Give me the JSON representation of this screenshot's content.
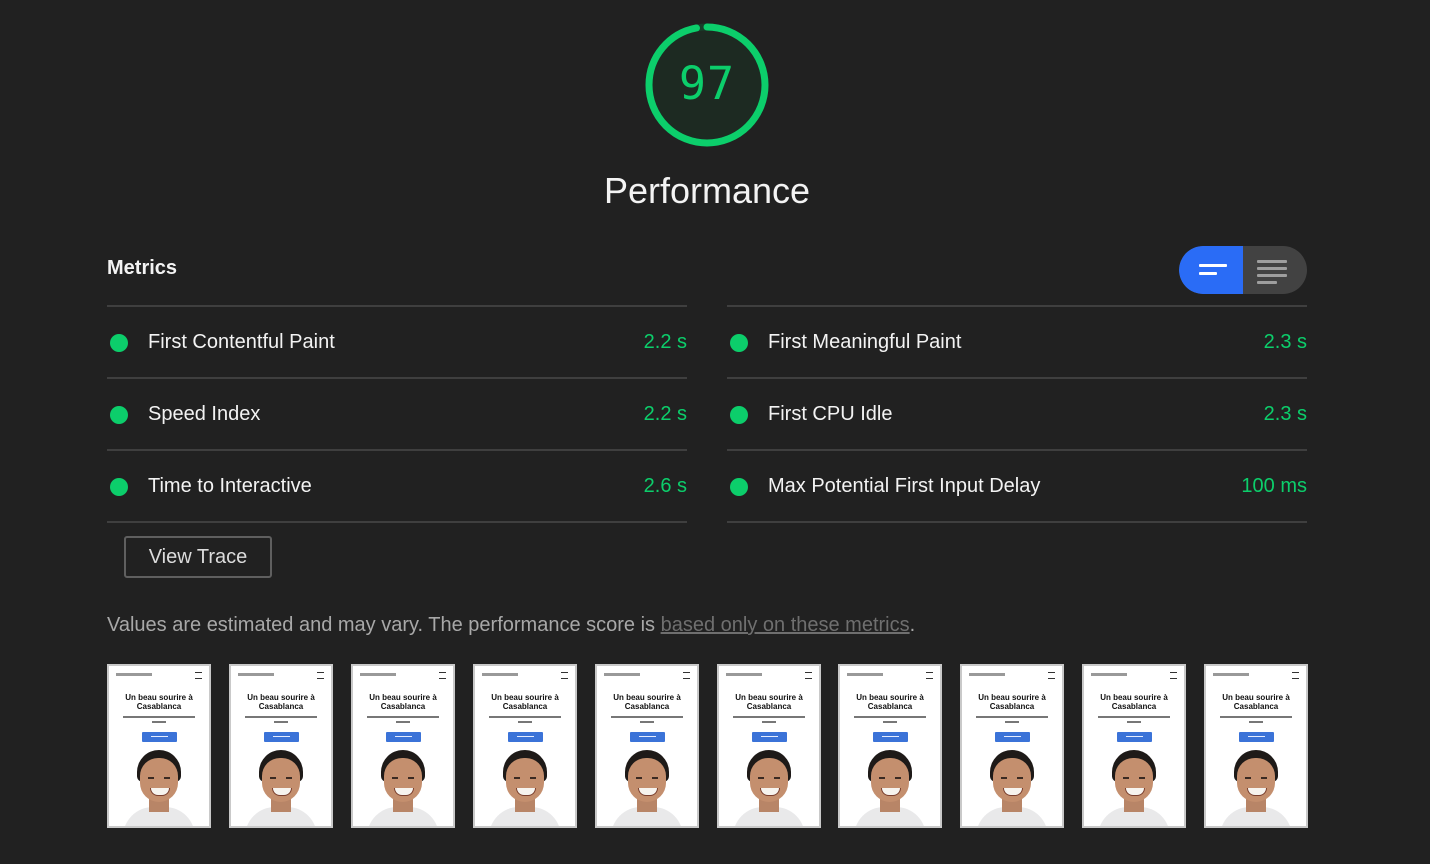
{
  "score": {
    "value": "97",
    "fraction": 0.97,
    "color": "#0cce6b",
    "track_color": "#1d3b2b"
  },
  "category": {
    "title": "Performance"
  },
  "metrics": {
    "heading": "Metrics",
    "toggle": {
      "compact_icon": "compact-view-icon",
      "expanded_icon": "expanded-view-icon",
      "active_color": "#2a6cf6"
    },
    "left": [
      {
        "label": "First Contentful Paint",
        "value": "2.2 s",
        "status": "pass"
      },
      {
        "label": "Speed Index",
        "value": "2.2 s",
        "status": "pass"
      },
      {
        "label": "Time to Interactive",
        "value": "2.6 s",
        "status": "pass"
      }
    ],
    "right": [
      {
        "label": "First Meaningful Paint",
        "value": "2.3 s",
        "status": "pass"
      },
      {
        "label": "First CPU Idle",
        "value": "2.3 s",
        "status": "pass"
      },
      {
        "label": "Max Potential First Input Delay",
        "value": "100 ms",
        "status": "pass"
      }
    ]
  },
  "view_trace_label": "View Trace",
  "footnote": {
    "text_before": "Values are estimated and may vary. The performance score is ",
    "link_text": "based only on these metrics",
    "text_after": "."
  },
  "filmstrip": {
    "frame_title": "Un beau sourire à Casablanca",
    "frame_count": 10
  }
}
